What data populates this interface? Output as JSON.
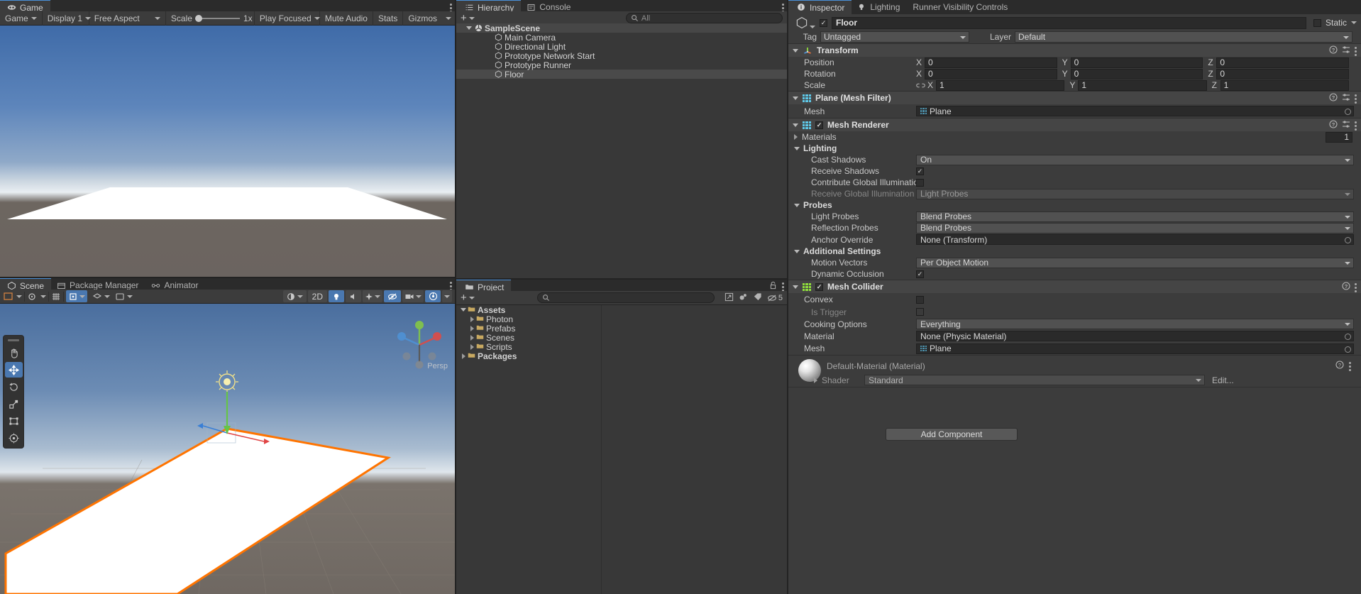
{
  "game": {
    "tab_label": "Game",
    "tab_icon": "gamepad-icon",
    "toolbar": {
      "target": "Game",
      "display": "Display 1",
      "aspect": "Free Aspect",
      "scale_label": "Scale",
      "scale_value": "1x",
      "play_mode": "Play Focused",
      "mute_audio": "Mute Audio",
      "stats": "Stats",
      "gizmos": "Gizmos"
    }
  },
  "scene": {
    "tabs": [
      {
        "label": "Scene",
        "icon": "scene-icon",
        "active": true
      },
      {
        "label": "Package Manager",
        "icon": "package-icon",
        "active": false
      },
      {
        "label": "Animator",
        "icon": "animator-icon",
        "active": false
      }
    ],
    "toolbar": {
      "shading": "Shaded",
      "mode_2d": "2D",
      "lighting": "lighting-icon",
      "audio": "audio-icon",
      "fx": "fx-icon",
      "hidden": "visibility-icon",
      "camera": "camera-icon",
      "gizmos": "gizmos-icon"
    },
    "tools": [
      "hand-tool",
      "move-tool",
      "rotate-tool",
      "scale-tool",
      "rect-tool",
      "transform-tool"
    ],
    "gizmo_label": "Persp"
  },
  "hierarchy": {
    "tabs": [
      {
        "label": "Hierarchy",
        "icon": "hierarchy-icon",
        "active": true
      },
      {
        "label": "Console",
        "icon": "console-icon",
        "active": false
      }
    ],
    "add_button": "+",
    "search_placeholder": "All",
    "search_value": "",
    "items": [
      {
        "label": "SampleScene",
        "depth": 0,
        "icon": "scene-asset-icon",
        "selected": false,
        "is_scene": true,
        "expanded": true
      },
      {
        "label": "Main Camera",
        "depth": 1,
        "icon": "gameobject-icon",
        "selected": false
      },
      {
        "label": "Directional Light",
        "depth": 1,
        "icon": "gameobject-icon",
        "selected": false
      },
      {
        "label": "Prototype Network Start",
        "depth": 1,
        "icon": "gameobject-icon",
        "selected": false
      },
      {
        "label": "Prototype Runner",
        "depth": 1,
        "icon": "gameobject-icon",
        "selected": false
      },
      {
        "label": "Floor",
        "depth": 1,
        "icon": "gameobject-icon",
        "selected": true
      }
    ]
  },
  "project": {
    "tab_label": "Project",
    "tab_icon": "folder-icon",
    "add_button": "+",
    "search_placeholder": "",
    "hidden_count": "5",
    "items": [
      {
        "label": "Assets",
        "depth": 0,
        "expanded": true
      },
      {
        "label": "Photon",
        "depth": 1,
        "expanded": false
      },
      {
        "label": "Prefabs",
        "depth": 1,
        "expanded": false
      },
      {
        "label": "Scenes",
        "depth": 1,
        "expanded": false
      },
      {
        "label": "Scripts",
        "depth": 1,
        "expanded": false
      },
      {
        "label": "Packages",
        "depth": 0,
        "expanded": false
      }
    ]
  },
  "inspector": {
    "tabs": [
      {
        "label": "Inspector",
        "icon": "info-icon",
        "active": true
      },
      {
        "label": "Lighting",
        "icon": "lightbulb-icon",
        "active": false
      },
      {
        "label": "Runner Visibility Controls",
        "icon": "",
        "active": false
      }
    ],
    "object": {
      "name": "Floor",
      "enabled": true,
      "static_label": "Static",
      "static_checked": false,
      "tag_label": "Tag",
      "tag_value": "Untagged",
      "layer_label": "Layer",
      "layer_value": "Default"
    },
    "transform": {
      "title": "Transform",
      "position": {
        "label": "Position",
        "x": "0",
        "y": "0",
        "z": "0"
      },
      "rotation": {
        "label": "Rotation",
        "x": "0",
        "y": "0",
        "z": "0"
      },
      "scale": {
        "label": "Scale",
        "x": "1",
        "y": "1",
        "z": "1"
      },
      "scale_link_icon": "link-broken-icon"
    },
    "mesh_filter": {
      "title": "Plane (Mesh Filter)",
      "mesh_label": "Mesh",
      "mesh_value": "Plane"
    },
    "mesh_renderer": {
      "title": "Mesh Renderer",
      "enabled": true,
      "materials_label": "Materials",
      "materials_count": "1",
      "lighting_label": "Lighting",
      "cast_shadows_label": "Cast Shadows",
      "cast_shadows_value": "On",
      "receive_shadows_label": "Receive Shadows",
      "receive_shadows_checked": true,
      "contribute_gi_label": "Contribute Global Illumination",
      "contribute_gi_checked": false,
      "receive_gi_label": "Receive Global Illumination",
      "receive_gi_value": "Light Probes",
      "probes_label": "Probes",
      "light_probes_label": "Light Probes",
      "light_probes_value": "Blend Probes",
      "reflection_probes_label": "Reflection Probes",
      "reflection_probes_value": "Blend Probes",
      "anchor_override_label": "Anchor Override",
      "anchor_override_value": "None (Transform)",
      "additional_settings_label": "Additional Settings",
      "motion_vectors_label": "Motion Vectors",
      "motion_vectors_value": "Per Object Motion",
      "dynamic_occlusion_label": "Dynamic Occlusion",
      "dynamic_occlusion_checked": true
    },
    "mesh_collider": {
      "title": "Mesh Collider",
      "enabled": true,
      "convex_label": "Convex",
      "convex_checked": false,
      "is_trigger_label": "Is Trigger",
      "is_trigger_checked": false,
      "cooking_options_label": "Cooking Options",
      "cooking_options_value": "Everything",
      "material_label": "Material",
      "material_value": "None (Physic Material)",
      "mesh_label": "Mesh",
      "mesh_value": "Plane"
    },
    "material": {
      "title": "Default-Material (Material)",
      "shader_label": "Shader",
      "shader_value": "Standard",
      "edit_label": "Edit..."
    },
    "add_component_label": "Add Component"
  },
  "colors": {
    "accent": "#4a90d9",
    "selection": "#4a4a4a",
    "panel_bg": "#383838",
    "toolbar_bg": "#3c3c3c",
    "selection_outline": "#ff7400"
  }
}
